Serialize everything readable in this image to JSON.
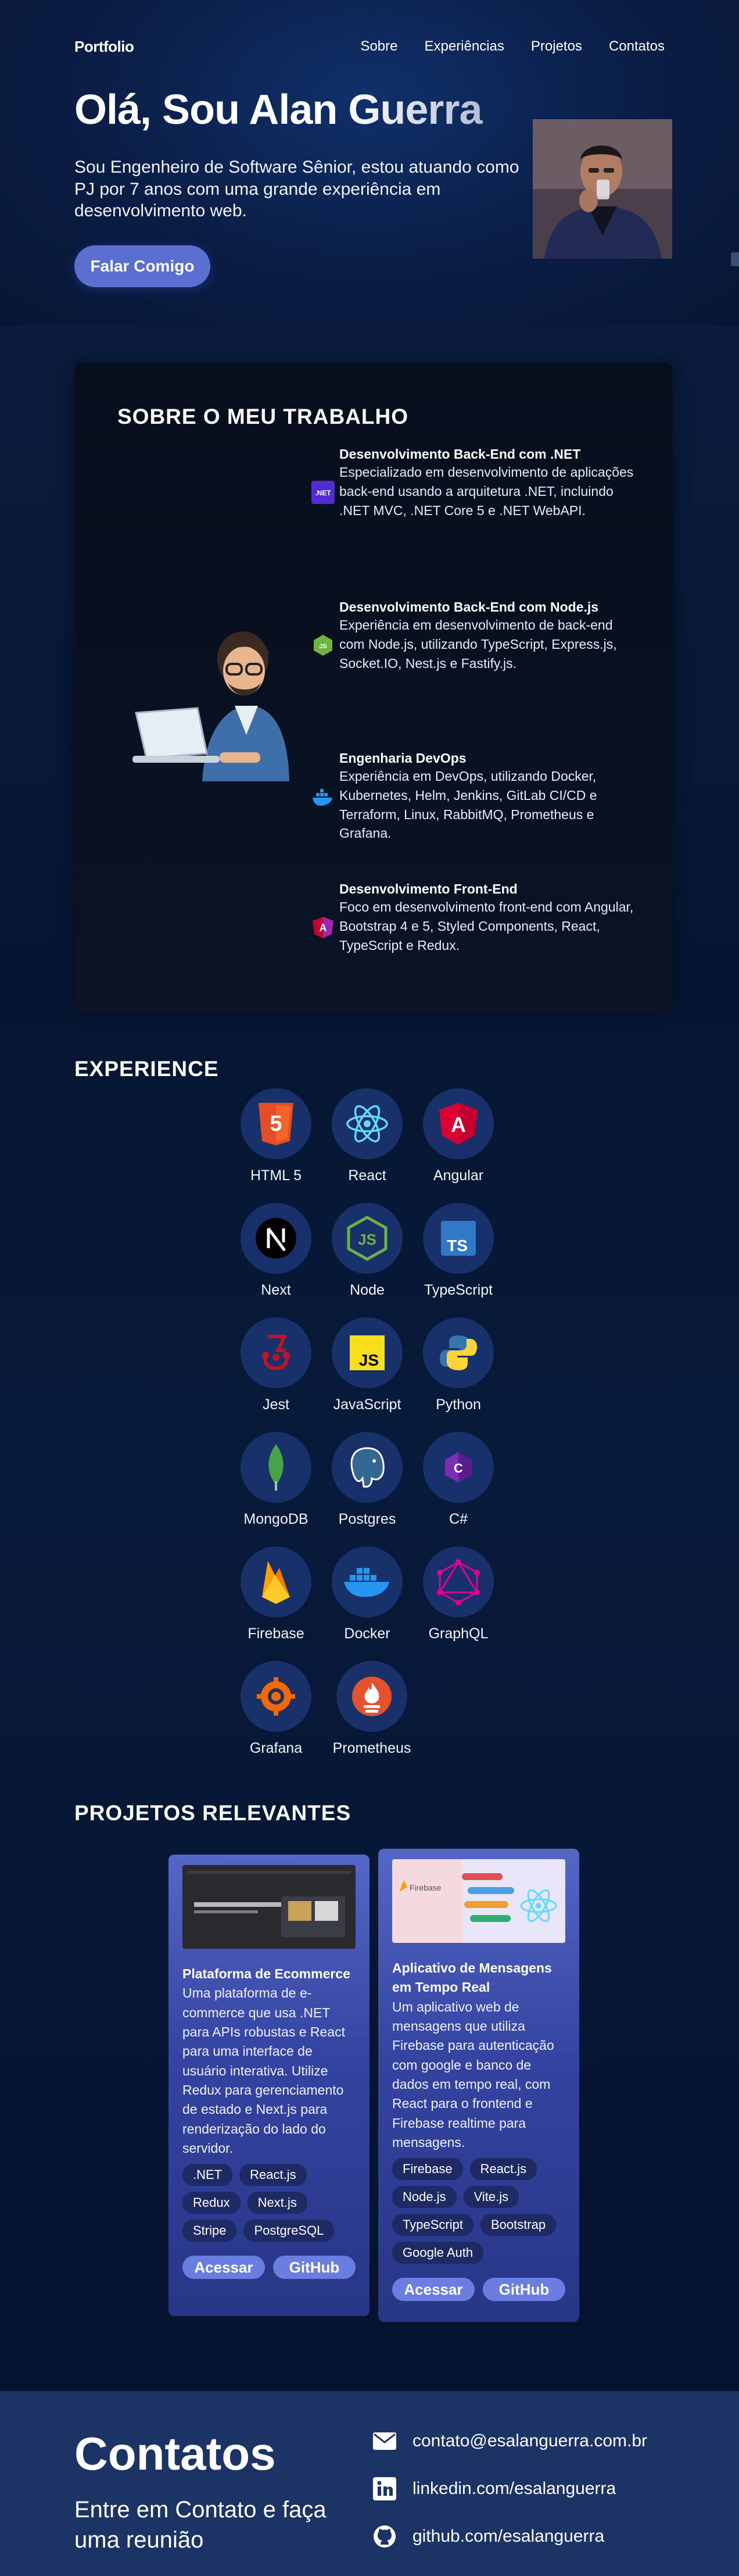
{
  "nav": {
    "logo": "Portfolio",
    "links": [
      "Sobre",
      "Experiências",
      "Projetos",
      "Contatos"
    ]
  },
  "hero": {
    "title": "Olá, Sou Alan Guerra",
    "subtitle": "Sou Engenheiro de Software Sênior, estou atuando como PJ por 7 anos com uma grande experiência em desenvolvimento web.",
    "cta": "Falar Comigo"
  },
  "about": {
    "title": "SOBRE O MEU TRABALHO",
    "items": [
      {
        "title": "Desenvolvimento Back-End com .NET",
        "text": "Especializado em desenvolvimento de aplicações back-end usando a arquitetura .NET, incluindo .NET MVC, .NET Core 5 e .NET WebAPI.",
        "icon": "dotnet-icon"
      },
      {
        "title": "Desenvolvimento Back-End com Node.js",
        "text": "Experiência em desenvolvimento de back-end com Node.js, utilizando TypeScript, Express.js, Socket.IO, Nest.js e Fastify.js.",
        "icon": "nodejs-icon"
      },
      {
        "title": "Engenharia DevOps",
        "text": "Experiência em DevOps, utilizando Docker, Kubernetes, Helm, Jenkins, GitLab CI/CD e Terraform, Linux, RabbitMQ, Prometheus e Grafana.",
        "icon": "docker-icon"
      },
      {
        "title": "Desenvolvimento Front-End",
        "text": "Foco em desenvolvimento front-end com Angular, Bootstrap 4 e 5, Styled Components, React, TypeScript e Redux.",
        "icon": "angular-icon"
      }
    ]
  },
  "experience": {
    "title": "EXPERIENCE",
    "techs": [
      "HTML 5",
      "React",
      "Angular",
      "Next",
      "Node",
      "TypeScript",
      "Jest",
      "JavaScript",
      "Python",
      "MongoDB",
      "Postgres",
      "C#",
      "Firebase",
      "Docker",
      "GraphQL",
      "Grafana",
      "Prometheus"
    ]
  },
  "projects": {
    "title": "PROJETOS RELEVANTES",
    "items": [
      {
        "title": "Plataforma de Ecommerce",
        "text": "Uma plataforma de e-commerce que usa .NET para APIs robustas e React para uma interface de usuário interativa. Utilize Redux para gerenciamento de estado e Next.js para renderização do lado do servidor.",
        "tags": [
          ".NET",
          "React.js",
          "Redux",
          "Next.js",
          "Stripe",
          "PostgreSQL"
        ],
        "access": "Acessar",
        "github": "GitHub"
      },
      {
        "title": "Aplicativo de Mensagens em Tempo Real",
        "text": "Um aplicativo web de mensagens que utiliza Firebase para autenticação com google e banco de dados em tempo real, com React para o frontend e Firebase realtime para mensagens.",
        "tags": [
          "Firebase",
          "React.js",
          "Node.js",
          "Vite.js",
          "TypeScript",
          "Bootstrap",
          "Google Auth"
        ],
        "access": "Acessar",
        "github": "GitHub",
        "thumb_label": "Firebase"
      }
    ]
  },
  "contacts": {
    "title": "Contatos",
    "subtitle": "Entre em Contato e faça uma reunião",
    "email": "contato@esalanguerra.com.br",
    "linkedin": "linkedin.com/esalanguerra",
    "github": "github.com/esalanguerra"
  }
}
